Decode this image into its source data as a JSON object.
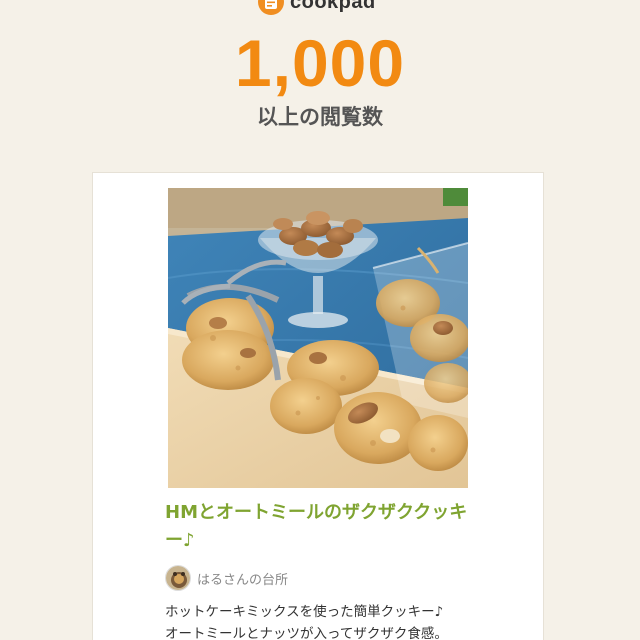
{
  "brand": {
    "name": "cookpad",
    "icon": "cookpad-logo-icon",
    "accent_color": "#f08e21"
  },
  "milestone": {
    "count": "1,000",
    "label": "以上の閲覧数",
    "count_color": "#f28a12"
  },
  "recipe": {
    "photo_icon": "recipe-photo",
    "title": "HMとオートミールのザクザククッキー♪",
    "title_color": "#7fa431",
    "author": {
      "avatar_icon": "author-avatar",
      "name": "はるさんの台所"
    },
    "description_lines": [
      "ホットケーキミックスを使った簡単クッキー♪",
      "オートミールとナッツが入ってザクザク食感。"
    ]
  }
}
